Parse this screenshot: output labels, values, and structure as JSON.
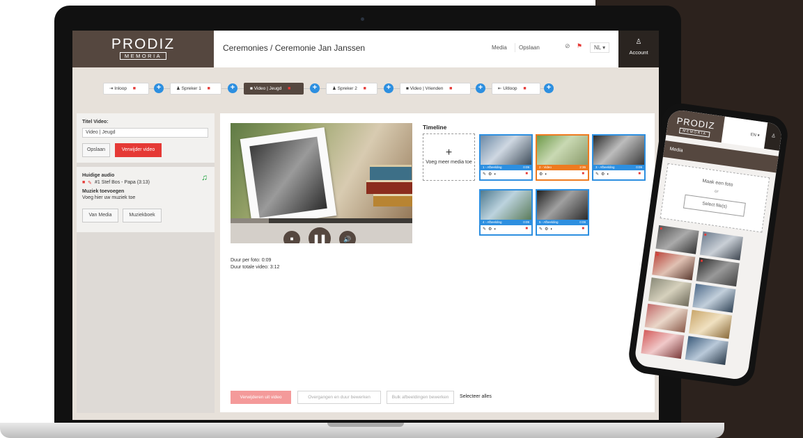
{
  "brand": {
    "name": "PRODIZ",
    "sub": "MEMORIA"
  },
  "breadcrumb": "Ceremonies / Ceremonie Jan Janssen",
  "topbar": {
    "media": "Media",
    "save": "Opslaan",
    "help_icon": "question-circle-icon",
    "flag_icon": "flag-icon",
    "language": "NL ▾",
    "account": "Account"
  },
  "steps": [
    {
      "icon": "⇥",
      "label": "Inloop",
      "active": false
    },
    {
      "icon": "♟",
      "label": "Spreker 1",
      "active": false
    },
    {
      "icon": "■",
      "label": "Video | Jeugd",
      "active": true
    },
    {
      "icon": "♟",
      "label": "Spreker 2",
      "active": false
    },
    {
      "icon": "■",
      "label": "Video | Vrienden",
      "active": false
    },
    {
      "icon": "⇤",
      "label": "Uitloop",
      "active": false
    }
  ],
  "left": {
    "title_label": "Titel Video:",
    "title_value": "Video | Jeugd",
    "save": "Opslaan",
    "delete_video": "Verwijder video",
    "current_audio_label": "Huidige audio",
    "current_audio_track": "#1 Stef Bos - Papa (3:13)",
    "add_music_label": "Muziek toevoegen",
    "add_music_hint": "Voeg hier uw muziek toe",
    "from_media": "Van Media",
    "music_book": "Muziekboek"
  },
  "player": {
    "progress": 0.21,
    "duration_per_photo": "Duur per foto: 0:09",
    "total_duration": "Duur totale video: 3:12"
  },
  "timeline": {
    "label": "Timeline",
    "add_media": "Voeg meer media toe",
    "tiles": [
      {
        "label": "1 - Afbeelding",
        "duration": "0:09",
        "kind": "image"
      },
      {
        "label": "2 - Video",
        "duration": "2:36",
        "kind": "video"
      },
      {
        "label": "3 - Afbeelding",
        "duration": "0:09",
        "kind": "image"
      },
      {
        "label": "4 - Afbeelding",
        "duration": "0:09",
        "kind": "image"
      },
      {
        "label": "5 - Afbeelding",
        "duration": "0:09",
        "kind": "image"
      }
    ]
  },
  "bottom": {
    "remove": "Verwijderen uit video",
    "transitions": "Overgangen en duur bewerken",
    "bulk": "Bulk afbeeldingen bewerken",
    "select_all": "Selecteer alles"
  },
  "phone": {
    "brand": "PRODIZ",
    "brand_sub": "MEMORIA",
    "language": "EN ▾",
    "media": "Media",
    "take_photo": "Maak een foto",
    "or": "or",
    "select_files": "Select file(s)"
  },
  "colors": {
    "brand_brown": "#55473f",
    "accent_blue": "#2d8fe0",
    "danger_red": "#e53935",
    "video_orange": "#ee7b20",
    "music_green": "#1aa23a"
  }
}
